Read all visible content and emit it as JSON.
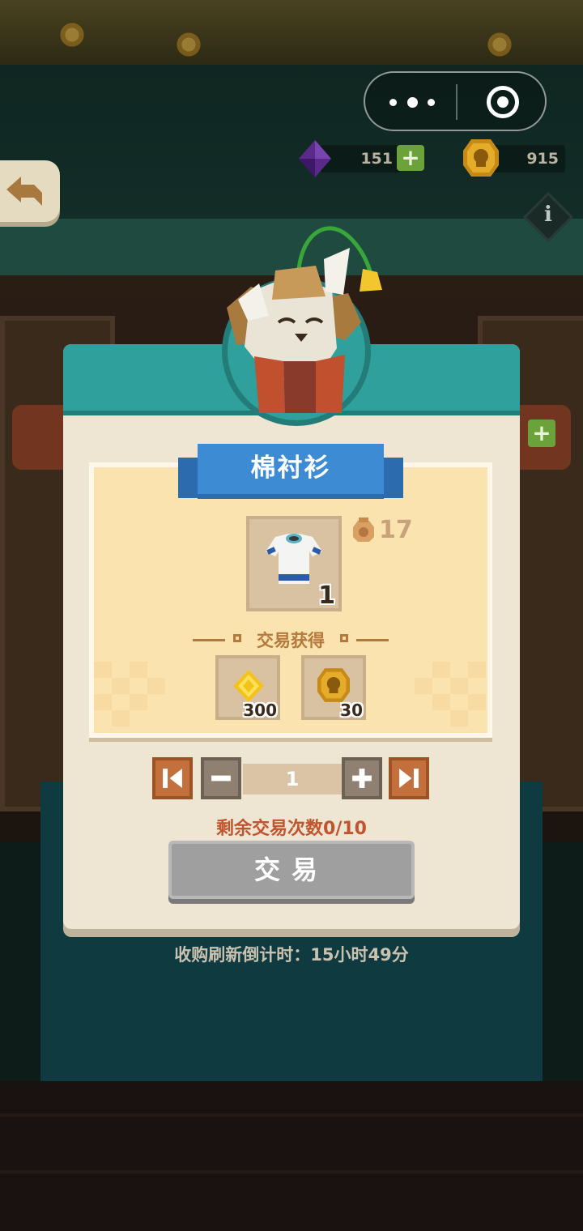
{
  "header": {
    "gem_count": "151",
    "coin_count": "915"
  },
  "item": {
    "name": "棉衬衫",
    "price": "17",
    "quantity_owned": "1"
  },
  "trade": {
    "label": "交易获得",
    "rewards": [
      {
        "icon": "yellow-gem-icon",
        "amount": "300"
      },
      {
        "icon": "skull-coin-icon",
        "amount": "30"
      }
    ],
    "quantity": "1",
    "remaining": "剩余交易次数0/10",
    "button": "交易"
  },
  "footer": {
    "countdown": "收购刷新倒计时：15小时49分"
  },
  "colors": {
    "teal": "#2fa09b",
    "ribbon_blue": "#3d8bd3",
    "panel_cream": "#fbe3af",
    "orange_button": "#c4703c",
    "disabled_gray": "#9f9f9f",
    "remaining_red": "#c1542e"
  }
}
